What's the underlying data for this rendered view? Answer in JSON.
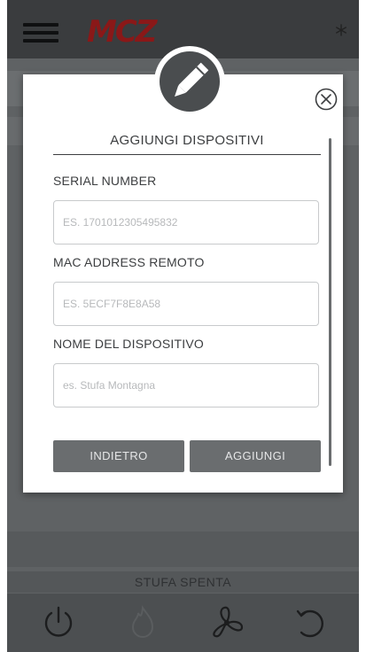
{
  "app": {
    "brand": "MCZ"
  },
  "modal": {
    "title": "AGGIUNGI DISPOSITIVI",
    "serial": {
      "label": "SERIAL NUMBER",
      "placeholder": "ES. 1701012305495832",
      "value": ""
    },
    "mac": {
      "label": "MAC ADDRESS REMOTO",
      "placeholder": "ES. 5ECF7F8E8A58",
      "value": ""
    },
    "name": {
      "label": "NOME DEL DISPOSITIVO",
      "placeholder": "es. Stufa Montagna",
      "value": ""
    },
    "back_label": "INDIETRO",
    "add_label": "AGGIUNGI"
  },
  "status": {
    "text": "STUFA SPENTA"
  },
  "icons": {
    "menu": "hamburger-menu-icon",
    "snow": "snowflake-icon",
    "edit": "pencil-icon",
    "close": "close-circle-icon",
    "power": "power-icon",
    "flame": "flame-icon",
    "fan": "fan-icon",
    "refresh": "refresh-icon"
  },
  "colors": {
    "brand": "#8a1818",
    "button": "#6a6d6f",
    "overlay": "#5f6264"
  }
}
